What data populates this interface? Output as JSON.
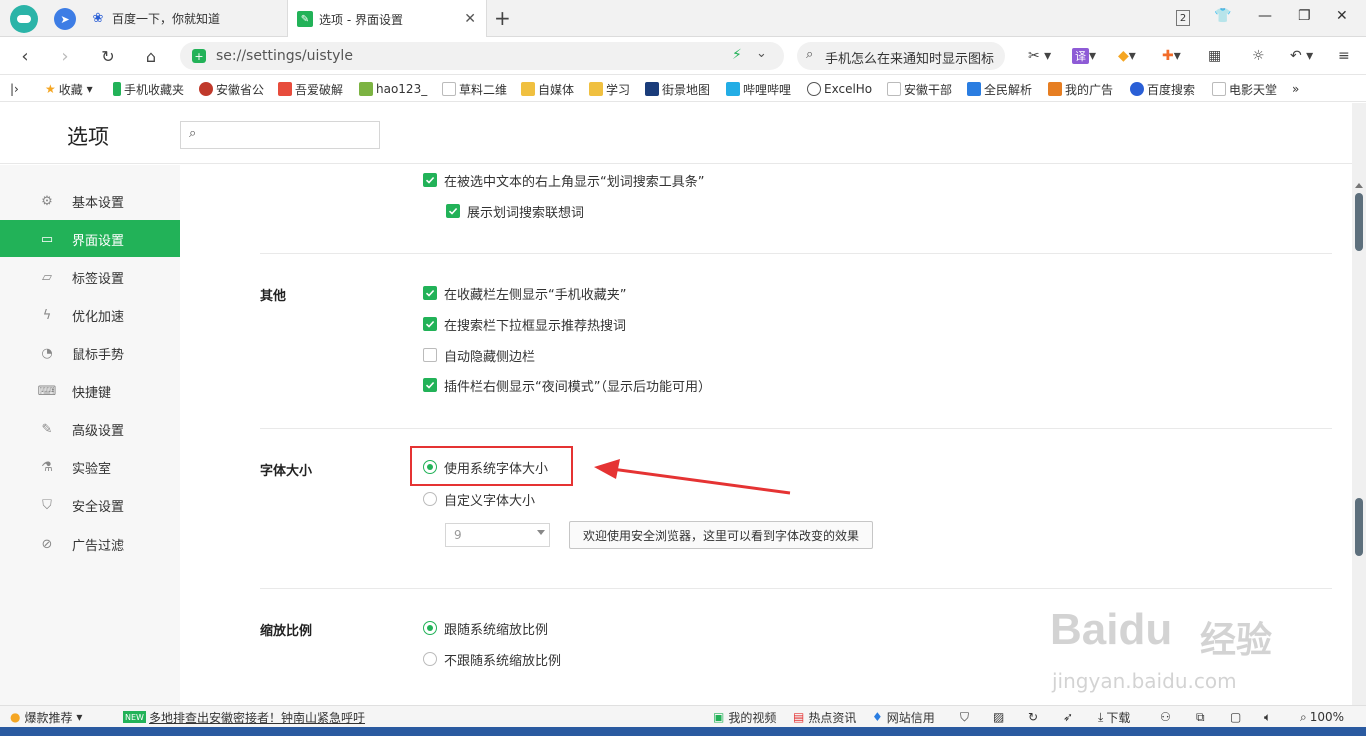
{
  "tabs": [
    {
      "label": "百度一下，你就知道",
      "icon": "baidu-paw-icon"
    },
    {
      "label": "选项 - 界面设置",
      "icon": "settings-wrench-icon"
    }
  ],
  "window": {
    "tab_count": "2"
  },
  "address": {
    "url": "se://settings/uistyle"
  },
  "search": {
    "text": "手机怎么在来通知时显示图标"
  },
  "bookmarks": [
    {
      "label": "收藏",
      "color": "#f5a623"
    },
    {
      "label": "手机收藏夹",
      "color": "#22b258"
    },
    {
      "label": "安徽省公",
      "color": "#c0392b"
    },
    {
      "label": "吾爱破解",
      "color": "#e74c3c"
    },
    {
      "label": "hao123_",
      "color": "#7cb342"
    },
    {
      "label": "草料二维",
      "color": "#bbbbbb"
    },
    {
      "label": "自媒体",
      "color": "#f0c040"
    },
    {
      "label": "学习",
      "color": "#f0c040"
    },
    {
      "label": "街景地图",
      "color": "#1a3c7a"
    },
    {
      "label": "哔哩哔哩",
      "color": "#23ade5"
    },
    {
      "label": "ExcelHo",
      "color": "#555555"
    },
    {
      "label": "安徽干部",
      "color": "#bbbbbb"
    },
    {
      "label": "全民解析",
      "color": "#2a7de1"
    },
    {
      "label": "我的广告",
      "color": "#e67e22"
    },
    {
      "label": "百度搜索",
      "color": "#2a5fd6"
    },
    {
      "label": "电影天堂",
      "color": "#bbbbbb"
    }
  ],
  "page": {
    "title": "选项"
  },
  "sidebar": {
    "items": [
      {
        "label": "基本设置",
        "icon": "gear-icon"
      },
      {
        "label": "界面设置",
        "icon": "window-icon",
        "active": true
      },
      {
        "label": "标签设置",
        "icon": "tab-icon"
      },
      {
        "label": "优化加速",
        "icon": "lightning-icon"
      },
      {
        "label": "鼠标手势",
        "icon": "mouse-icon"
      },
      {
        "label": "快捷键",
        "icon": "keyboard-icon"
      },
      {
        "label": "高级设置",
        "icon": "wrench-icon"
      },
      {
        "label": "实验室",
        "icon": "flask-icon"
      },
      {
        "label": "安全设置",
        "icon": "shield-icon"
      },
      {
        "label": "广告过滤",
        "icon": "block-icon"
      }
    ]
  },
  "content": {
    "top_options": [
      {
        "label": "在被选中文本的右上角显示“划词搜索工具条”",
        "checked": true
      },
      {
        "label": "展示划词搜索联想词",
        "checked": true
      }
    ],
    "other": {
      "title": "其他",
      "options": [
        {
          "label": "在收藏栏左侧显示“手机收藏夹”",
          "checked": true
        },
        {
          "label": "在搜索栏下拉框显示推荐热搜词",
          "checked": true
        },
        {
          "label": "自动隐藏侧边栏",
          "checked": false
        },
        {
          "label": "插件栏右侧显示“夜间模式”（显示后功能可用）",
          "checked": true
        }
      ]
    },
    "font_size": {
      "title": "字体大小",
      "options": [
        {
          "label": "使用系统字体大小",
          "selected": true
        },
        {
          "label": "自定义字体大小",
          "selected": false
        }
      ],
      "select_value": "9",
      "preview": "欢迎使用安全浏览器，这里可以看到字体改变的效果"
    },
    "zoom": {
      "title": "缩放比例",
      "options": [
        {
          "label": "跟随系统缩放比例",
          "selected": true
        },
        {
          "label": "不跟随系统缩放比例",
          "selected": false
        }
      ]
    }
  },
  "statusbar": {
    "recommend": "爆款推荐",
    "news_badge": "NEW",
    "news": "多地排查出安徽密接者！钟南山紧急呼吁",
    "my_video": "我的视频",
    "hot_news": "热点资讯",
    "credit": "网站信用",
    "download": "下载",
    "zoom": "100%"
  },
  "watermark": {
    "brand": "Baidu",
    "brand_cn": "经验",
    "url": "jingyan.baidu.com"
  },
  "colors": {
    "accent": "#22b258",
    "highlight": "#e53333"
  }
}
